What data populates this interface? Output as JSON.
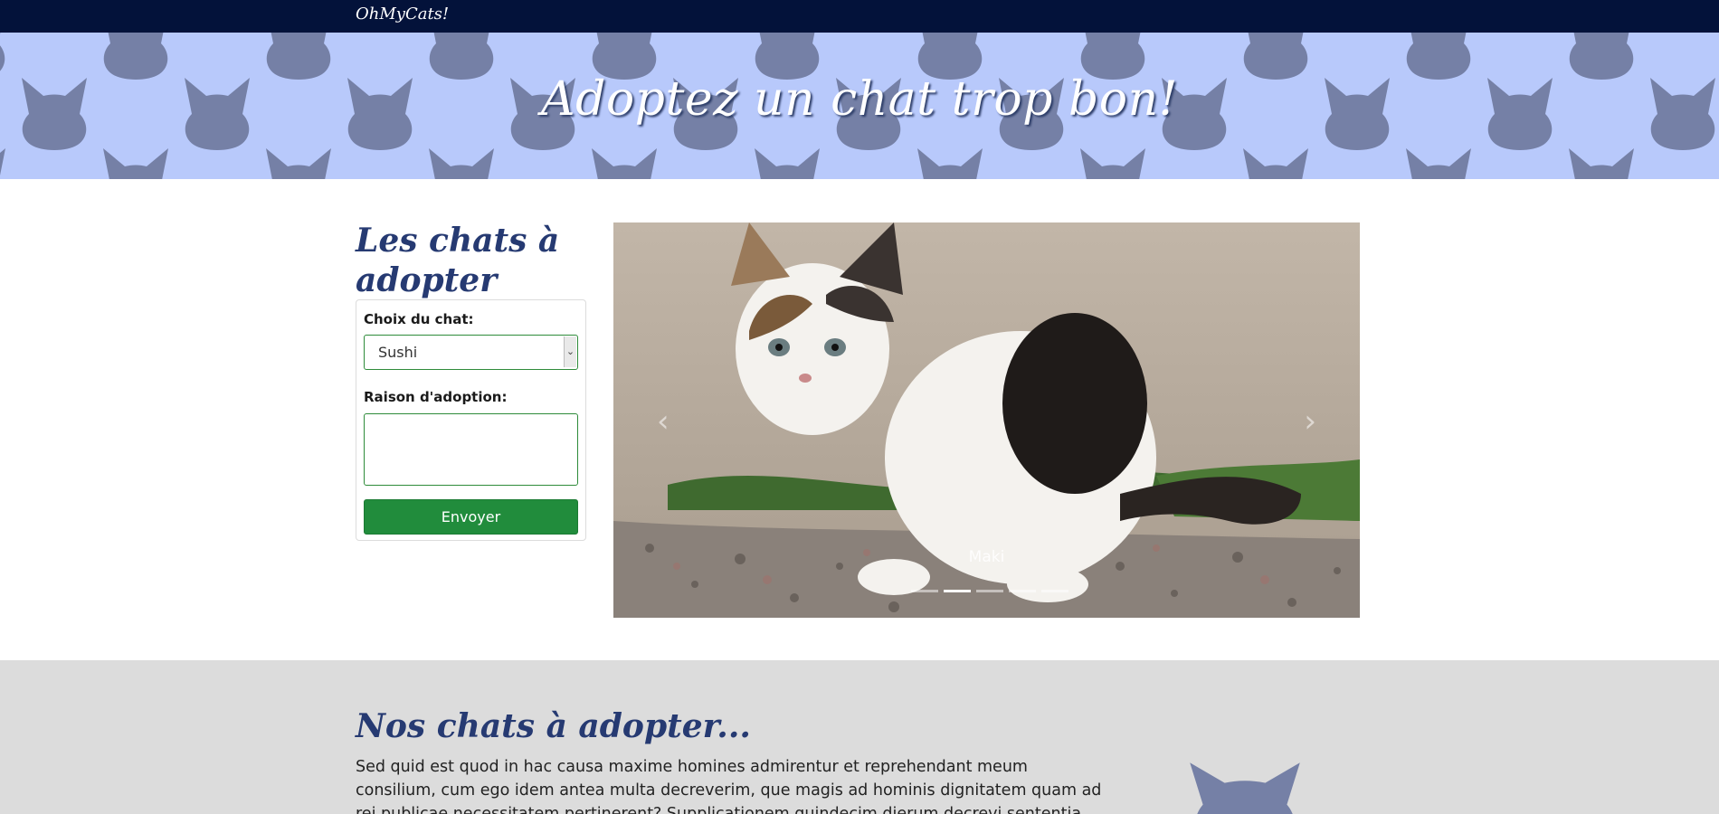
{
  "navbar": {
    "brand": "OhMyCats!"
  },
  "hero": {
    "title": "Adoptez un chat trop bon!"
  },
  "sidebar": {
    "title": "Les chats à adopter",
    "form": {
      "cat_label": "Choix du chat:",
      "cat_selected": "Sushi",
      "reason_label": "Raison d'adoption:",
      "reason_value": "",
      "submit_label": "Envoyer"
    }
  },
  "carousel": {
    "caption": "Maki",
    "prev_icon": "chevron-left-icon",
    "next_icon": "chevron-right-icon",
    "indicator_count": 5,
    "active_index": 1
  },
  "about": {
    "title": "Nos chats à adopter...",
    "text": "Sed quid est quod in hac causa maxime homines admirentur et reprehendant meum consilium, cum ego idem antea multa decreverim, que magis ad hominis dignitatem quam ad rei publicae necessitatem pertinerent? Supplicationem quindecim dierum decrevi sententia mea. Rei publicae satis erat tot dierum"
  },
  "colors": {
    "navbar_bg": "#03123a",
    "hero_bg": "#b8c9fb",
    "cat_silhouette": "#7580a6",
    "heading": "#263a72",
    "button_green": "#218c3c",
    "lower_bg": "#dcdcdc"
  }
}
